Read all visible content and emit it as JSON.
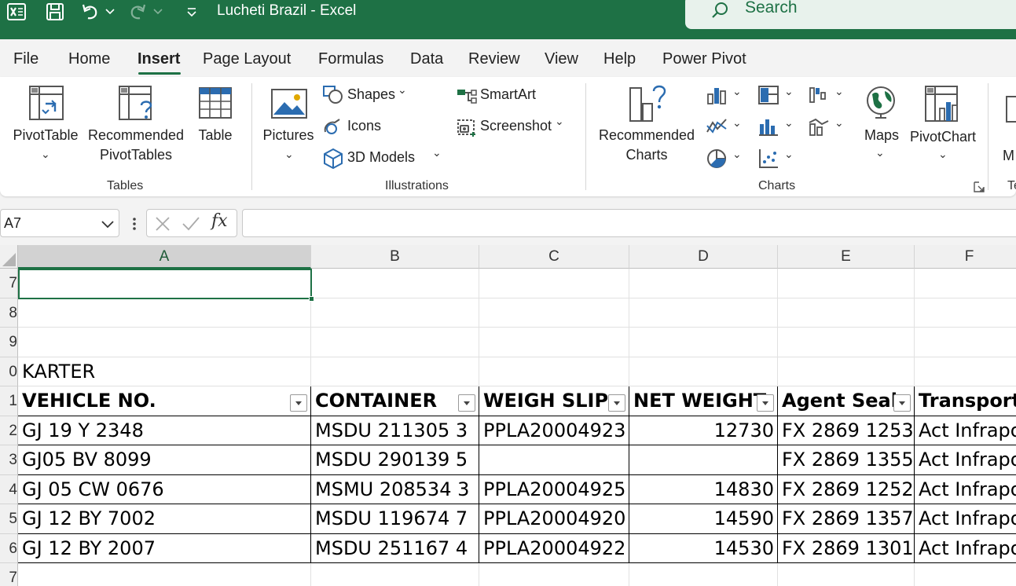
{
  "titlebar": {
    "title": "Lucheti Brazil  -  Excel",
    "search_label": "Search"
  },
  "tabs": [
    "File",
    "Home",
    "Insert",
    "Page Layout",
    "Formulas",
    "Data",
    "Review",
    "View",
    "Help",
    "Power Pivot"
  ],
  "ribbon": {
    "tables": {
      "pivottable": "PivotTable",
      "recommended_pivot_1": "Recommended",
      "recommended_pivot_2": "PivotTables",
      "table": "Table",
      "group": "Tables"
    },
    "illustrations": {
      "pictures": "Pictures",
      "shapes": "Shapes",
      "icons": "Icons",
      "models": "3D Models",
      "smartart": "SmartArt",
      "screenshot": "Screenshot",
      "group": "Illustrations"
    },
    "charts": {
      "recommended_1": "Recommended",
      "recommended_2": "Charts",
      "maps": "Maps",
      "pivotchart": "PivotChart",
      "group": "Charts"
    },
    "partial_label": "M",
    "partial_group": "Te"
  },
  "formula_bar": {
    "name_box": "A7",
    "fx": "fx",
    "formula": ""
  },
  "grid": {
    "columns": [
      "A",
      "B",
      "C",
      "D",
      "E",
      "F"
    ],
    "row_numbers": [
      "7",
      "8",
      "9",
      "0",
      "1",
      "2",
      "3",
      "4",
      "5",
      "6",
      "7"
    ],
    "section_label": "KARTER",
    "headers": [
      "VEHICLE NO.",
      "CONTAINER",
      "WEIGH SLIP",
      "NET WEIGHT",
      "Agent Seal",
      "Transporte"
    ],
    "rows": [
      [
        "GJ 19 Y 2348",
        "MSDU 211305 3",
        "PPLA20004923",
        "12730",
        "FX 2869 1253",
        "Act Infrapo"
      ],
      [
        "GJ05 BV 8099",
        "MSDU 290139 5",
        "",
        "",
        "FX 2869 1355",
        "Act Infrapo"
      ],
      [
        "GJ 05 CW 0676",
        "MSMU 208534 3",
        "PPLA20004925",
        "14830",
        "FX 2869 1252",
        "Act Infrapo"
      ],
      [
        "GJ 12 BY 7002",
        "MSDU 119674 7",
        "PPLA20004920",
        "14590",
        "FX 2869 1357",
        "Act Infrapo"
      ],
      [
        "GJ 12 BY 2007",
        "MSDU 251167 4",
        "PPLA20004922",
        "14530",
        "FX 2869 1301",
        "Act Infrapo"
      ]
    ]
  },
  "colors": {
    "excel_green": "#1e7145",
    "ribbon_bg": "#f3f3f3"
  }
}
